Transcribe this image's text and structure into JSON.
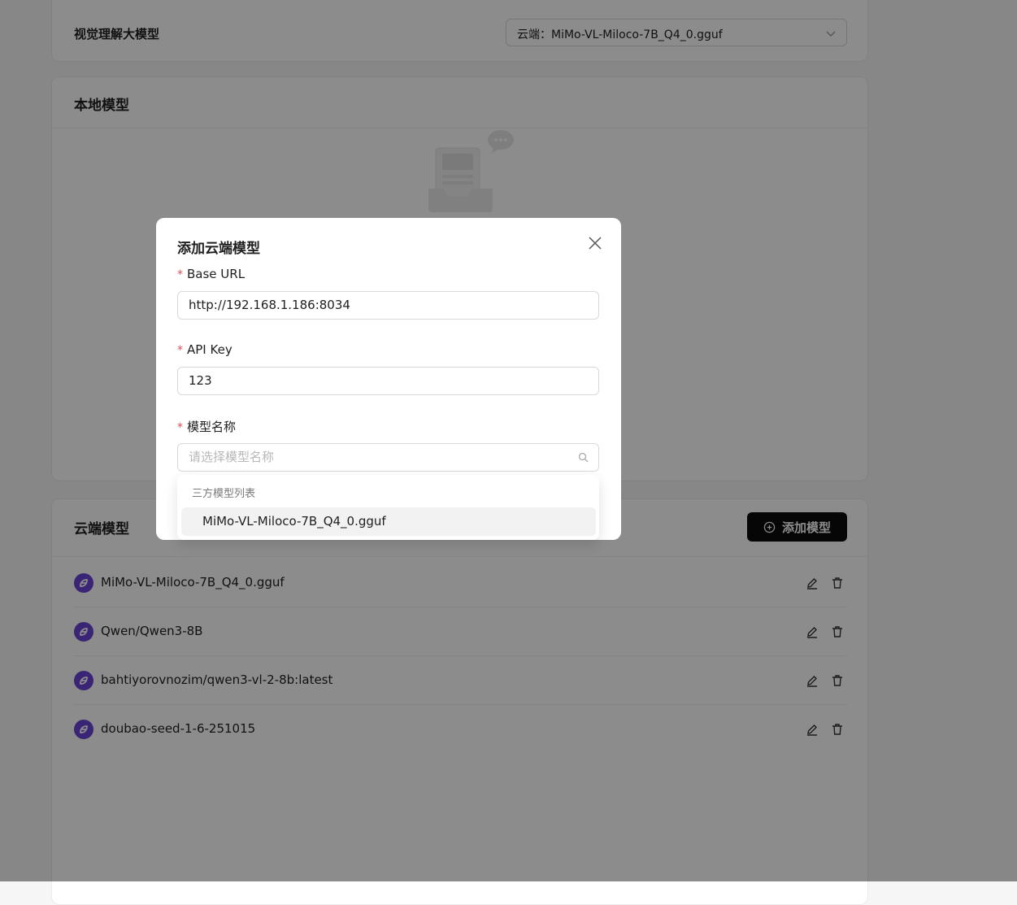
{
  "vision_model": {
    "label": "视觉理解大模型",
    "selected": "云端：MiMo-VL-Miloco-7B_Q4_0.gguf"
  },
  "local_models": {
    "title": "本地模型"
  },
  "cloud_models": {
    "title": "云端模型",
    "add_button_label": "添加模型",
    "items": [
      {
        "name": "MiMo-VL-Miloco-7B_Q4_0.gguf"
      },
      {
        "name": "Qwen/Qwen3-8B"
      },
      {
        "name": "bahtiyorovnozim/qwen3-vl-2-8b:latest"
      },
      {
        "name": "doubao-seed-1-6-251015"
      }
    ]
  },
  "modal": {
    "title": "添加云端模型",
    "required_mark": "*",
    "base_url": {
      "label": "Base URL",
      "value": "http://192.168.1.186:8034"
    },
    "api_key": {
      "label": "API Key",
      "value": "123"
    },
    "model_name": {
      "label": "模型名称",
      "placeholder": "请选择模型名称"
    },
    "dropdown": {
      "group_label": "三方模型列表",
      "options": [
        "MiMo-VL-Miloco-7B_Q4_0.gguf"
      ]
    }
  },
  "colors": {
    "accent_purple": "#6a43d6",
    "button_black": "#0b0b0b",
    "required_red": "#e34d59"
  }
}
